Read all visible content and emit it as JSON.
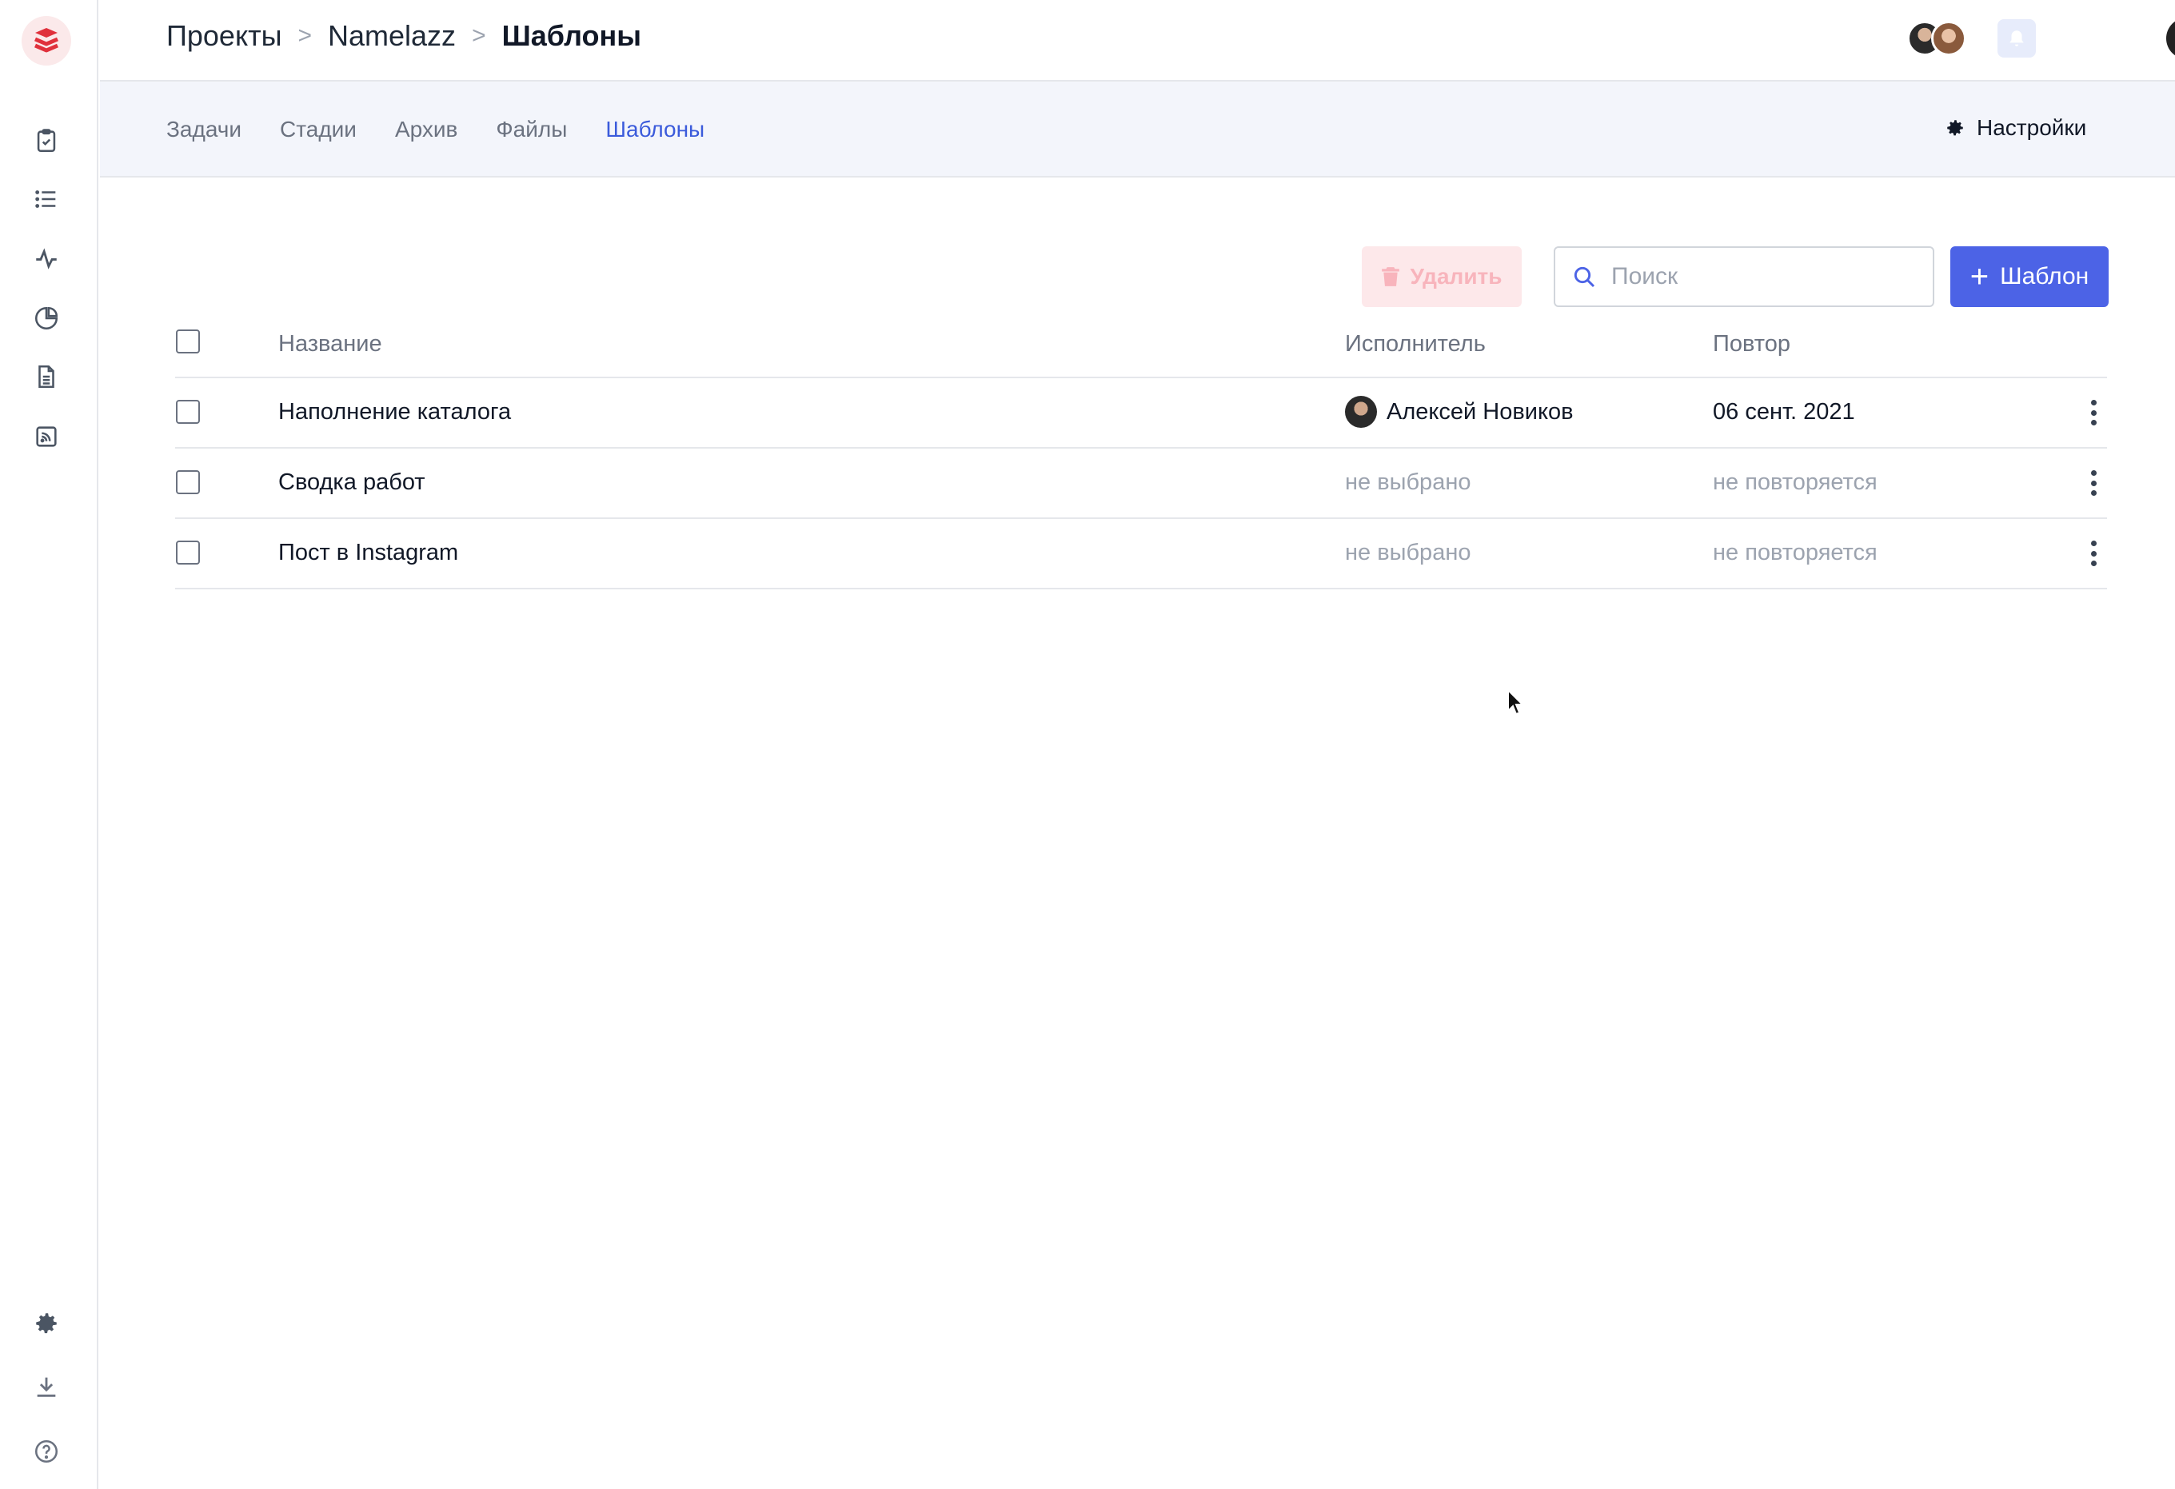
{
  "sidebar": {
    "icons": [
      "logo-icon",
      "tasks-icon",
      "list-icon",
      "activity-icon",
      "reports-icon",
      "document-icon",
      "feed-icon",
      "settings-icon",
      "download-icon",
      "help-icon"
    ]
  },
  "header": {
    "breadcrumb": {
      "projects": "Проекты",
      "project": "Namelazz",
      "current": "Шаблоны",
      "separator": ">"
    }
  },
  "subnav": {
    "tabs": [
      {
        "label": "Задачи"
      },
      {
        "label": "Стадии"
      },
      {
        "label": "Архив"
      },
      {
        "label": "Файлы"
      },
      {
        "label": "Шаблоны",
        "active": true
      }
    ],
    "settings_label": "Настройки"
  },
  "toolbar": {
    "delete_label": "Удалить",
    "search_placeholder": "Поиск",
    "add_label": "Шаблон"
  },
  "table": {
    "headers": {
      "name": "Название",
      "assignee": "Исполнитель",
      "repeat": "Повтор"
    },
    "rows": [
      {
        "name": "Наполнение каталога",
        "assignee": "Алексей Новиков",
        "repeat": "06 сент. 2021"
      },
      {
        "name": "Сводка работ",
        "assignee": "не выбрано",
        "repeat": "не повторяется"
      },
      {
        "name": "Пост в Instagram",
        "assignee": "не выбрано",
        "repeat": "не повторяется"
      }
    ]
  },
  "colors": {
    "accent": "#4c63e6",
    "active_tab": "#3b5bdb",
    "brand": "#e0313c",
    "delete_bg": "#fde8ea"
  }
}
